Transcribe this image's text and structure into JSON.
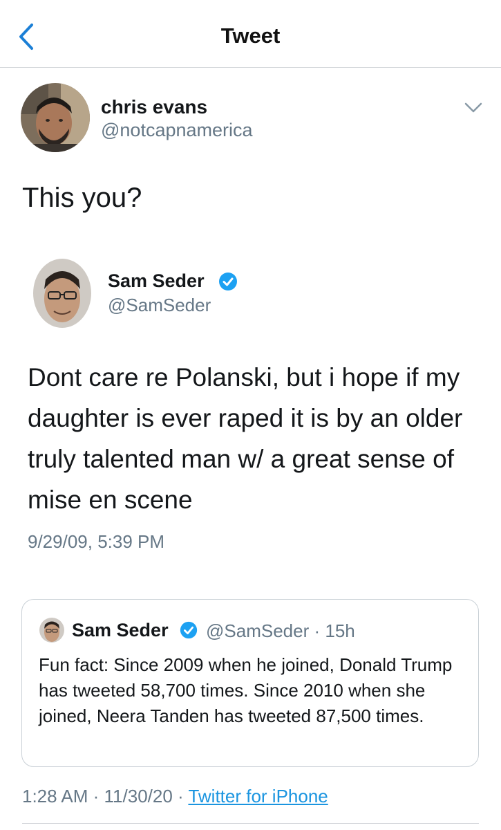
{
  "nav": {
    "title": "Tweet"
  },
  "tweet": {
    "author_name": "chris evans",
    "author_handle": "@notcapnamerica",
    "text": "This you?"
  },
  "embedded": {
    "author_name": "Sam Seder",
    "author_handle": "@SamSeder",
    "text": "Dont care re Polanski, but i hope if my daughter is ever raped it is by an older truly talented man w/ a great sense of mise en scene",
    "date": "9/29/09, 5:39 PM"
  },
  "quote": {
    "author_name": "Sam Seder",
    "author_handle": "@SamSeder",
    "sep": "·",
    "time": "15h",
    "text": "Fun fact: Since 2009 when he joined, Donald Trump has tweeted 58,700 times. Since 2010 when she joined, Neera Tanden has tweeted 87,500 times."
  },
  "footer": {
    "time": "1:28 AM",
    "sep1": " · ",
    "date": "11/30/20",
    "sep2": " · ",
    "source": "Twitter for iPhone"
  },
  "colors": {
    "verified": "#1da1f2",
    "link": "#1b95e0",
    "muted": "#657786"
  },
  "icons": [
    "back-chevron-icon",
    "chevron-down-icon",
    "verified-badge-icon"
  ]
}
